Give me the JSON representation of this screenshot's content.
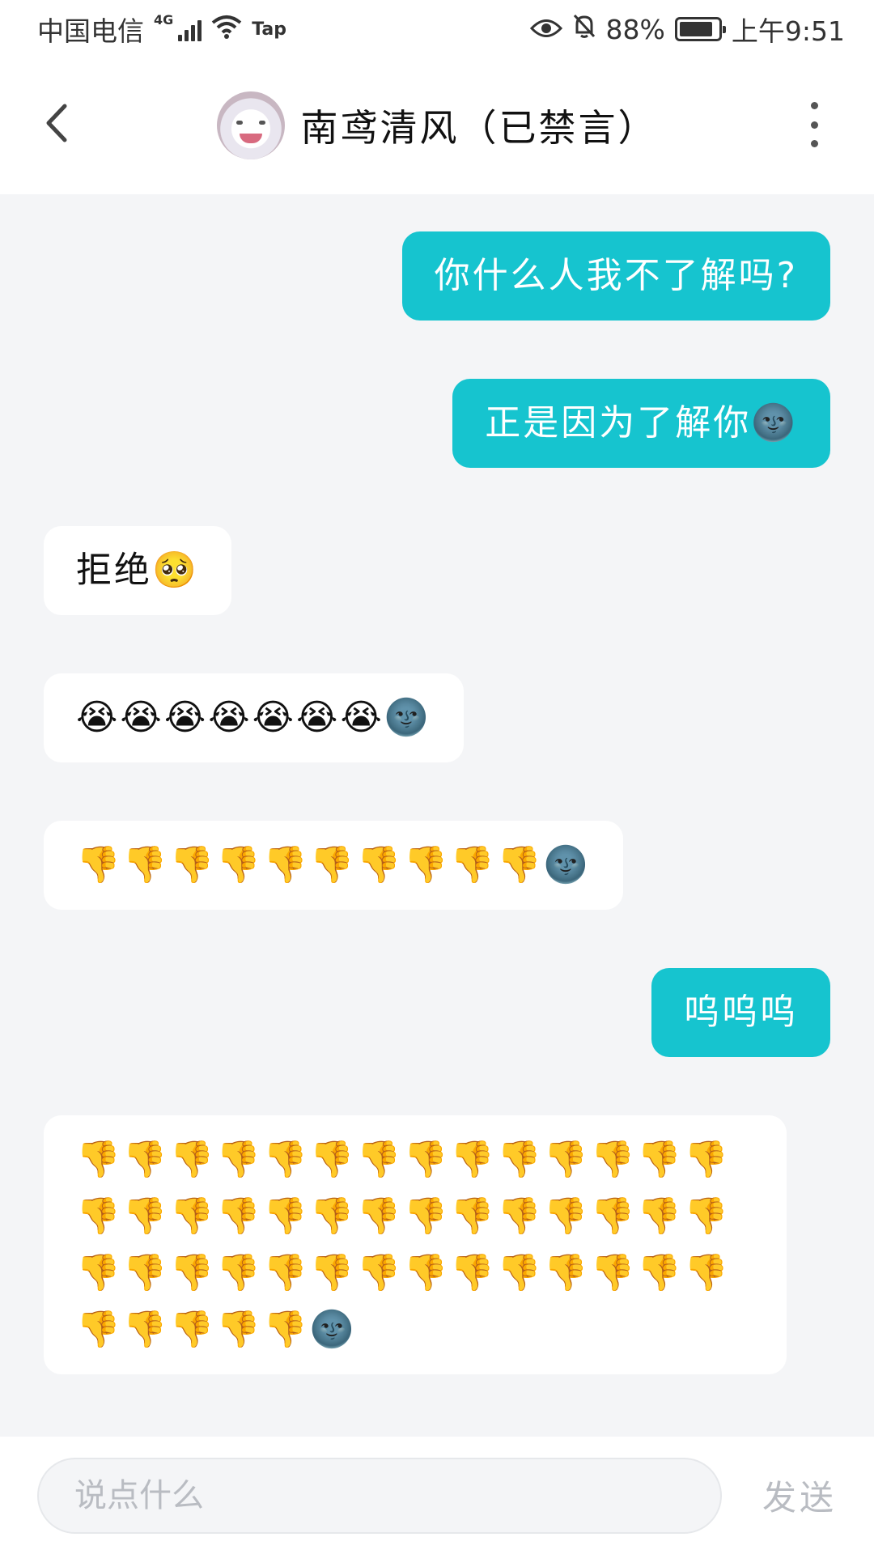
{
  "status_bar": {
    "carrier": "中国电信",
    "network": "4G",
    "tap_label": "Tap",
    "battery_percent": "88%",
    "battery_level": 0.88,
    "time": "上午9:51",
    "icons": [
      "signal-icon",
      "wifi-icon",
      "eye-icon",
      "bell-off-icon",
      "battery-icon"
    ]
  },
  "header": {
    "title": "南鸢清风（已禁言）",
    "back_icon": "chevron-left-icon",
    "more_icon": "more-vertical-icon"
  },
  "messages": [
    {
      "direction": "out",
      "text": "你什么人我不了解吗?"
    },
    {
      "direction": "out",
      "text": "正是因为了解你🌚"
    },
    {
      "direction": "in",
      "text": "拒绝🥺"
    },
    {
      "direction": "in",
      "text": "😭😭😭😭😭😭😭🌚"
    },
    {
      "direction": "in",
      "text": "👎👎👎👎👎👎👎👎👎👎🌚"
    },
    {
      "direction": "out",
      "text": "呜呜呜"
    },
    {
      "direction": "in",
      "text": "👎👎👎👎👎👎👎👎👎👎👎👎👎👎👎👎👎👎👎👎👎👎👎👎👎👎👎👎👎👎👎👎👎👎👎👎👎👎👎👎👎👎👎👎👎👎👎🌚"
    }
  ],
  "input": {
    "placeholder": "说点什么",
    "value": "",
    "send_label": "发送"
  },
  "colors": {
    "outgoing_bubble": "#16c4cf",
    "incoming_bubble": "#ffffff",
    "chat_background": "#f4f5f7"
  }
}
